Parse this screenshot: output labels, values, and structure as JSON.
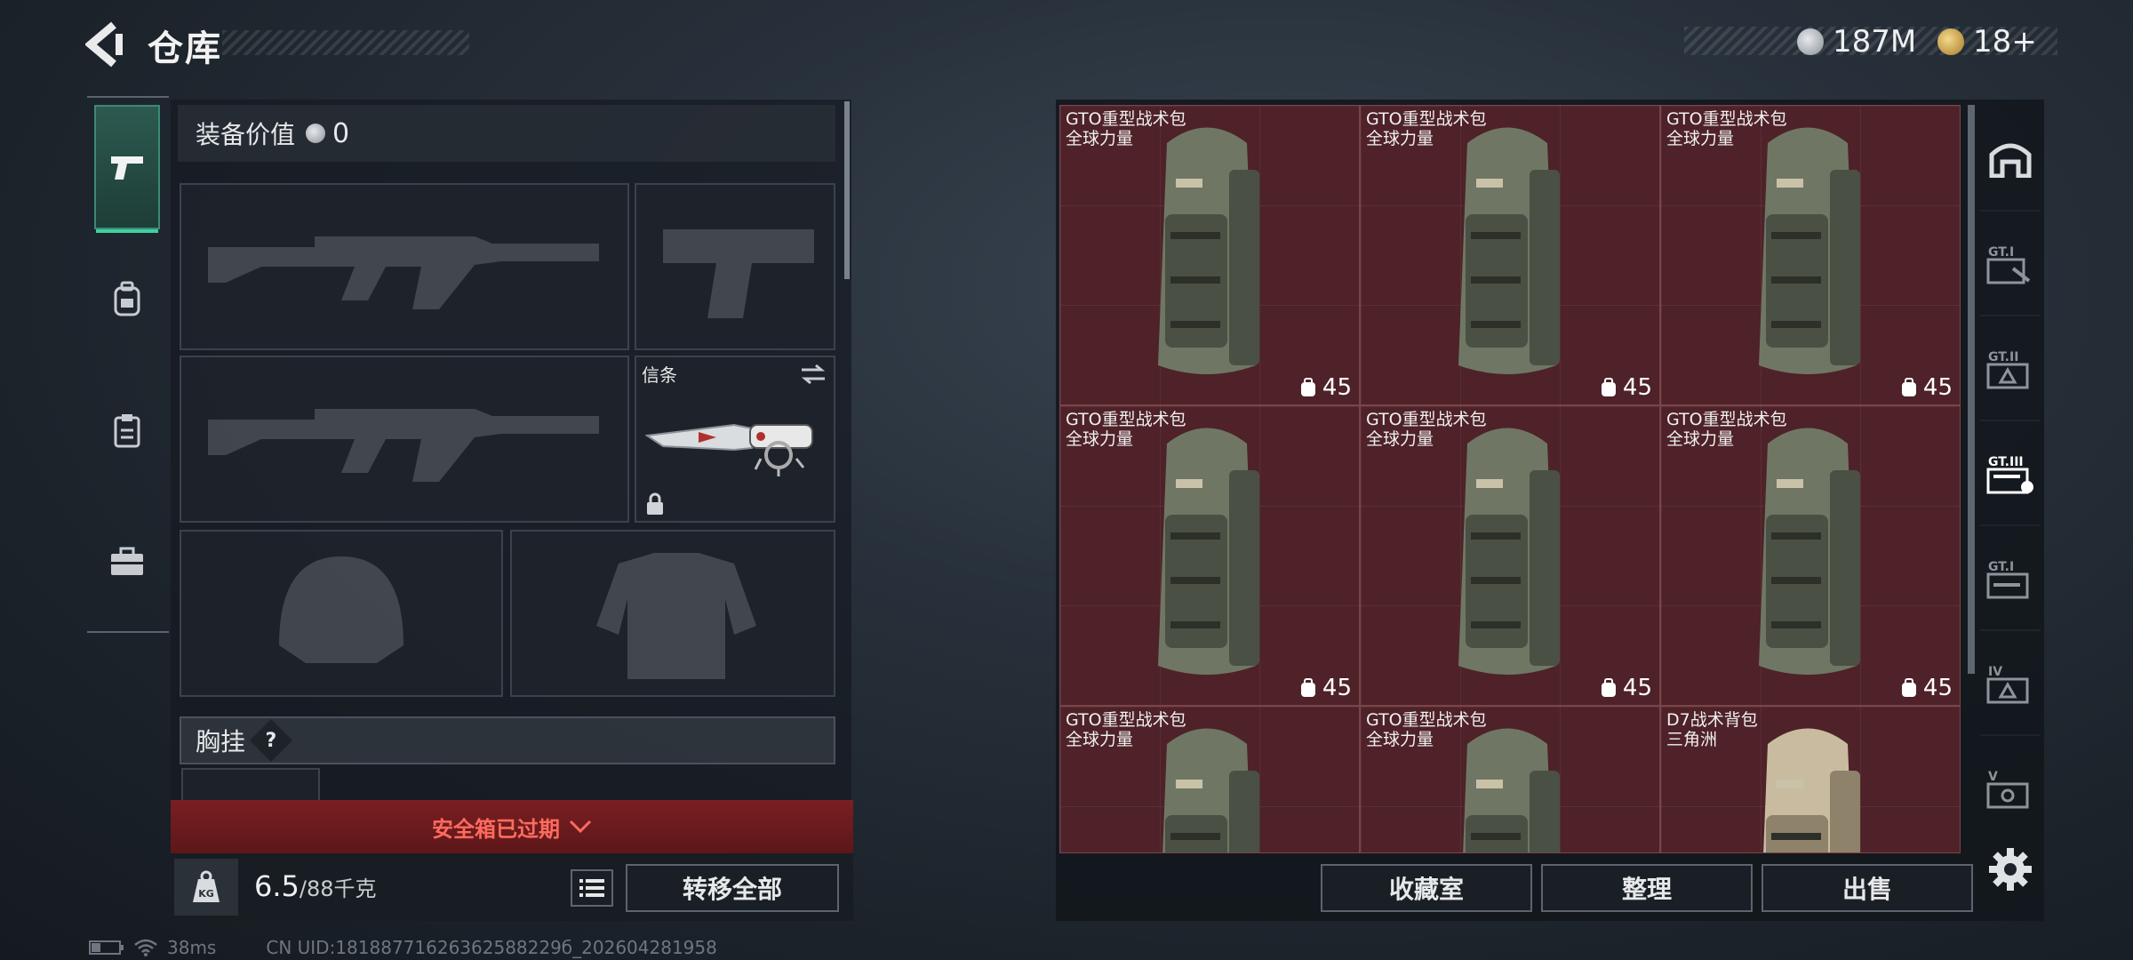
{
  "header": {
    "title": "仓库",
    "currency_1": "187M",
    "currency_2": "18+",
    "currency_1_color": "#c9cdd2",
    "currency_2_color": "#d4a94a"
  },
  "left_tabs": [
    {
      "icon": "pistol-icon",
      "active": true
    },
    {
      "icon": "backpack-icon",
      "active": false
    },
    {
      "icon": "clipboard-icon",
      "active": false
    },
    {
      "icon": "toolbox-icon",
      "active": false
    }
  ],
  "loadout": {
    "gear_value_label": "装备价值",
    "gear_value": "0",
    "melee_label": "信条",
    "chest_rig_label": "胸挂",
    "chest_rig_help": "?",
    "expired_notice": "安全箱已过期"
  },
  "bottom_left": {
    "weight_current": "6.5",
    "weight_max": "/88千克",
    "weight_icon_text": "KG",
    "transfer_all": "转移全部"
  },
  "storage": {
    "items": [
      {
        "name": "GTO重型战术包",
        "sub": "全球力量",
        "capacity": "45",
        "variant": "green"
      },
      {
        "name": "GTO重型战术包",
        "sub": "全球力量",
        "capacity": "45",
        "variant": "green"
      },
      {
        "name": "GTO重型战术包",
        "sub": "全球力量",
        "capacity": "45",
        "variant": "green"
      },
      {
        "name": "GTO重型战术包",
        "sub": "全球力量",
        "capacity": "45",
        "variant": "green"
      },
      {
        "name": "GTO重型战术包",
        "sub": "全球力量",
        "capacity": "45",
        "variant": "green"
      },
      {
        "name": "GTO重型战术包",
        "sub": "全球力量",
        "capacity": "45",
        "variant": "green"
      },
      {
        "name": "GTO重型战术包",
        "sub": "全球力量",
        "capacity": "",
        "variant": "green"
      },
      {
        "name": "GTO重型战术包",
        "sub": "全球力量",
        "capacity": "",
        "variant": "green"
      },
      {
        "name": "D7战术背包",
        "sub": "三角洲",
        "capacity": "",
        "variant": "tan"
      }
    ],
    "colors": {
      "cell_bg": "#4e2228",
      "pack_green": "#6f7764",
      "pack_tan": "#c9bba0"
    }
  },
  "right_tabs": [
    "armory-icon",
    "gti-1",
    "gti-2",
    "gti-3",
    "gti-4",
    "tier-iv",
    "tier-v"
  ],
  "right_tab_labels": [
    "",
    "GT.I",
    "GT.II",
    "GT.III",
    "GT.I",
    "IV",
    "V"
  ],
  "bottom_right": {
    "collection": "收藏室",
    "organize": "整理",
    "sell": "出售"
  },
  "status_bar": {
    "ping": "38ms",
    "uid": "CN UID:18188771626362588229б_202604281958"
  }
}
